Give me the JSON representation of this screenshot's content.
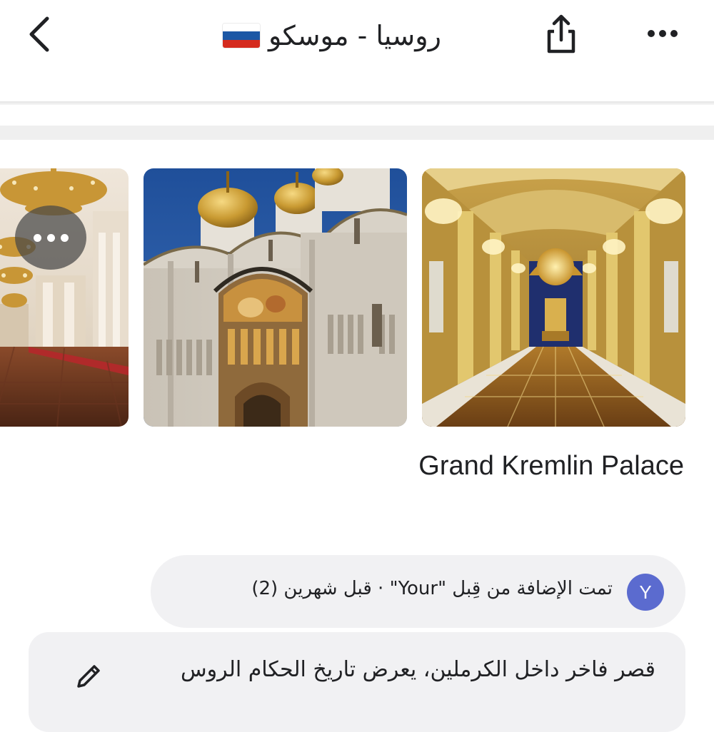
{
  "header": {
    "title": "روسيا - موسكو",
    "flag_icon": "russia-flag-icon",
    "back_icon": "chevron-left-icon",
    "share_icon": "share-icon",
    "more_icon": "more-horizontal-icon"
  },
  "flag_colors": [
    "#ffffff",
    "#1c57a5",
    "#d52b1e"
  ],
  "photos": [
    {
      "name": "palace-hall-photo",
      "more_icon": "more-horizontal-icon"
    },
    {
      "name": "cathedral-photo"
    },
    {
      "name": "throne-hall-photo"
    }
  ],
  "place": {
    "name": "Grand Kremlin Palace"
  },
  "added": {
    "avatar_letter": "Y",
    "text": "تمت الإضافة من قِبل \"Your\" · قبل شهرين (2)"
  },
  "note": {
    "text": "قصر فاخر داخل الكرملين، يعرض تاريخ الحكام الروس",
    "edit_icon": "pencil-icon"
  },
  "colors": {
    "avatar_bg": "#5b6bcf",
    "pill_bg": "#f1f1f3"
  }
}
